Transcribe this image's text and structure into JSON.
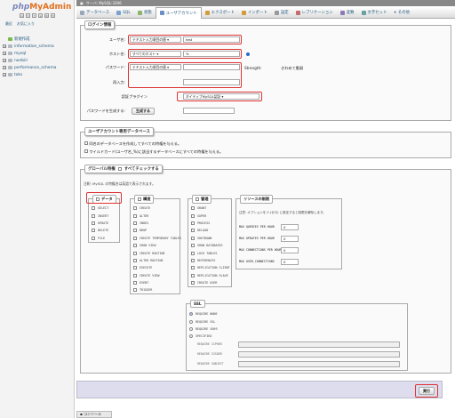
{
  "navigation": {
    "logo_php": "php",
    "logo_my": "My",
    "logo_admin": "Admin",
    "recent_label": "最近",
    "favorites_label": "お気に入り",
    "new_label": "新規作成",
    "databases": [
      "information_schema",
      "mysql",
      "nonbiri",
      "performance_schema",
      "toks"
    ]
  },
  "server_bar": {
    "label": "サーバ: MySQL:3306"
  },
  "tabs": [
    {
      "label": "データベース"
    },
    {
      "label": "SQL"
    },
    {
      "label": "状態"
    },
    {
      "label": "ユーザアカウント"
    },
    {
      "label": "エクスポート"
    },
    {
      "label": "インポート"
    },
    {
      "label": "設定"
    },
    {
      "label": "レプリケーション"
    },
    {
      "label": "変数"
    },
    {
      "label": "文字セット"
    },
    {
      "label": "その他"
    }
  ],
  "login_info": {
    "legend": "ログイン情報",
    "username_label": "ユーザ名:",
    "username_type": "テキスト入力項目の値",
    "username_value": "test",
    "host_label": "ホスト名:",
    "host_type": "すべてのホスト",
    "host_value": "%",
    "password_label": "パスワード:",
    "password_type": "テキスト入力項目の値",
    "strength_label": "Strength:",
    "strength_value": "きわめて脆弱",
    "reenter_label": "再入力:",
    "auth_plugin_label": "認証プラグイン",
    "auth_plugin_value": "ネイティブMySQL認証",
    "generate_label": "パスワードを生成する:",
    "generate_button": "生成する"
  },
  "user_db": {
    "legend": "ユーザアカウント専用データベース",
    "option1": "同名のデータベースを作成してすべての特権を与える。",
    "option2": "ワイルドカード(ユーザ名_%)に該当するデータベースにすべての特権を与える。"
  },
  "global_privs": {
    "legend": "グローバル特権",
    "check_all": "すべてチェックする",
    "note": "注釈: MySQL の特権名は英語で表示されます。",
    "data": {
      "title": "データ",
      "items": [
        "SELECT",
        "INSERT",
        "UPDATE",
        "DELETE",
        "FILE"
      ]
    },
    "structure": {
      "title": "構造",
      "items": [
        "CREATE",
        "ALTER",
        "INDEX",
        "DROP",
        "CREATE TEMPORARY TABLES",
        "SHOW VIEW",
        "CREATE ROUTINE",
        "ALTER ROUTINE",
        "EXECUTE",
        "CREATE VIEW",
        "EVENT",
        "TRIGGER"
      ]
    },
    "admin": {
      "title": "管理",
      "items": [
        "GRANT",
        "SUPER",
        "PROCESS",
        "RELOAD",
        "SHUTDOWN",
        "SHOW DATABASES",
        "LOCK TABLES",
        "REFERENCES",
        "REPLICATION CLIENT",
        "REPLICATION SLAVE",
        "CREATE USER"
      ]
    },
    "resources": {
      "title": "リソースの制限",
      "note": "注意: オプションを 0 (ゼロ) に設定すると制限を解除します。",
      "rows": [
        {
          "label": "MAX QUERIES PER HOUR",
          "value": "0"
        },
        {
          "label": "MAX UPDATES PER HOUR",
          "value": "0"
        },
        {
          "label": "MAX CONNECTIONS PER HOUR",
          "value": "0"
        },
        {
          "label": "MAX USER_CONNECTIONS",
          "value": "0"
        }
      ]
    },
    "ssl": {
      "title": "SSL",
      "options": [
        "REQUIRE NONE",
        "REQUIRE SSL",
        "REQUIRE X509",
        "SPECIFIED"
      ],
      "fields": [
        "REQUIRE CIPHER",
        "REQUIRE ISSUER",
        "REQUIRE SUBJECT"
      ]
    }
  },
  "footer": {
    "go_button": "実行"
  },
  "console_label": "コンソール"
}
